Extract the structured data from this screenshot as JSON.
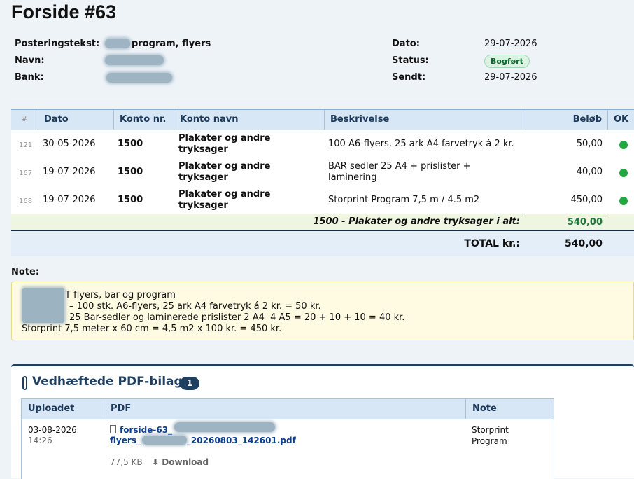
{
  "page": {
    "title": "Forside #63"
  },
  "meta": {
    "posting_label": "Posteringstekst:",
    "posting_value": "program, flyers",
    "name_label": "Navn:",
    "bank_label": "Bank:",
    "date_label": "Dato:",
    "date_value": "29-07-2026",
    "status_label": "Status:",
    "status_value": "Bogført",
    "sent_label": "Sendt:",
    "sent_value": "29-07-2026"
  },
  "colors": {
    "ok": "#22a93f",
    "badge_bg": "#dcf3e3",
    "header_bg": "#d7e7f5",
    "accent": "#1f3f60"
  },
  "table": {
    "headers": [
      "#",
      "Dato",
      "Konto nr.",
      "Konto navn",
      "Beskrivelse",
      "Beløb",
      "OK"
    ],
    "rows": [
      {
        "num": "121",
        "date": "30-05-2026",
        "account": "1500",
        "name_1": "Plakater og andre",
        "name_2": "tryksager",
        "desc_1": "100 A6-flyers, 25 ark A4 farvetryk á 2 kr.",
        "desc_2": "",
        "amount": "50,00"
      },
      {
        "num": "167",
        "date": "19-07-2026",
        "account": "1500",
        "name_1": "Plakater og andre",
        "name_2": "tryksager",
        "desc_1": "BAR sedler 25 A4 + prislister +",
        "desc_2": "laminering",
        "amount": "40,00"
      },
      {
        "num": "168",
        "date": "19-07-2026",
        "account": "1500",
        "name_1": "Plakater og andre",
        "name_2": "tryksager",
        "desc_1": "Storprint Program 7,5 m / 4.5 m2",
        "desc_2": "",
        "amount": "450,00"
      }
    ],
    "subtotal_label": "1500 - Plakater og andre tryksager i alt:",
    "subtotal_value": "540,00",
    "total_label": "TOTAL kr.:",
    "total_value": "540,00"
  },
  "note": {
    "label": "Note:",
    "lines": [
      "T flyers, bar og program",
      "– 100 stk. A6-flyers, 25 ark A4 farvetryk á 2 kr. = 50 kr.",
      "25 Bar-sedler og laminerede prislister 2 A4  4 A5 = 20 + 10 + 10 = 40 kr.",
      "Storprint 7,5 meter x 60 cm = 4,5 m2 x 100 kr. = 450 kr."
    ]
  },
  "attachments": {
    "title": "Vedhæftede PDF-bilag",
    "count": "1",
    "headers": [
      "Uploadet",
      "PDF",
      "Note"
    ],
    "item": {
      "date": "03-08-2026",
      "time": "14:26",
      "file_part1": "forside-63_",
      "file_part2_a": "flyers_",
      "file_part2_b": "_20260803_142601.pdf",
      "size": "77,5 KB",
      "download": "⬇ Download",
      "note_1": "Storprint",
      "note_2": "Program"
    }
  }
}
